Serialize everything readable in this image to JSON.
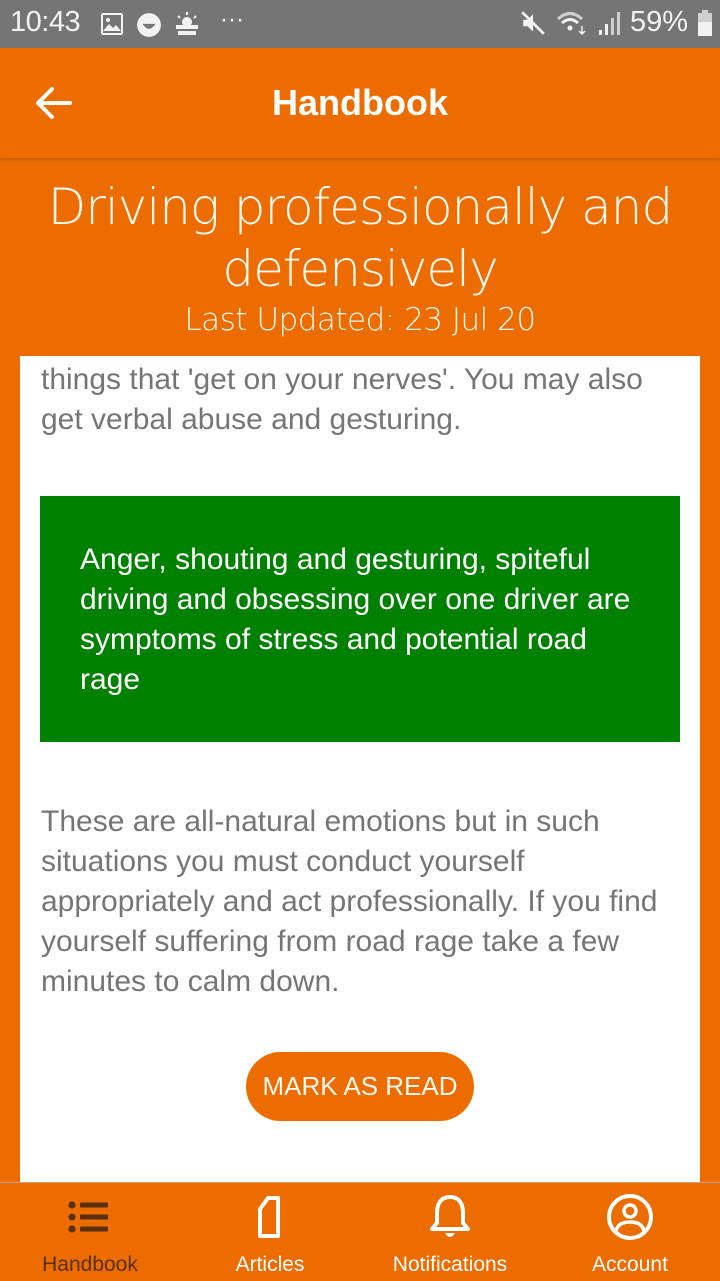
{
  "status_bar": {
    "time": "10:43",
    "battery": "59%",
    "left_icons": [
      "gallery-icon",
      "smiley-icon",
      "weather-icon",
      "more-icon"
    ],
    "right_icons": [
      "mute-icon",
      "wifi-icon",
      "signal-icon",
      "battery-icon"
    ]
  },
  "app_bar": {
    "title": "Handbook",
    "back_icon": "arrow-back-icon"
  },
  "article": {
    "title": "Driving professionally and defensively",
    "last_updated": "Last Updated: 23 Jul 20",
    "paragraph_1": "things that 'get on your nerves'. You may also get verbal abuse and gesturing.",
    "callout": "Anger, shouting and gesturing, spiteful driving and obsessing over one driver are symptoms of stress and potential road rage",
    "paragraph_2": "These are all-natural emotions but in such situations you must conduct yourself appropriately and act professionally. If you find yourself suffering from road rage take a few minutes to calm down.",
    "mark_read_label": "MARK AS READ"
  },
  "colors": {
    "brand": "#ec6c00",
    "callout": "#008000",
    "body_text": "#757575",
    "active_tab": "#5a2e10"
  },
  "bottom_nav": {
    "items": [
      {
        "label": "Handbook",
        "icon": "list-icon",
        "active": true
      },
      {
        "label": "Articles",
        "icon": "document-icon",
        "active": false
      },
      {
        "label": "Notifications",
        "icon": "bell-icon",
        "active": false
      },
      {
        "label": "Account",
        "icon": "account-circle-icon",
        "active": false
      }
    ]
  }
}
